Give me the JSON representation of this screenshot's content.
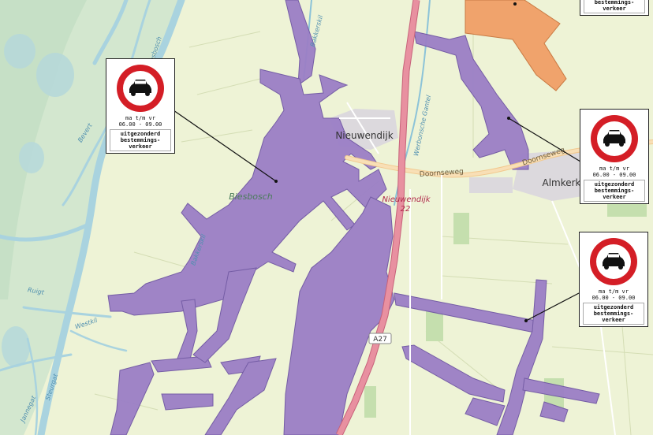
{
  "colors": {
    "background": "#eef3d6",
    "water": "#a9d3df",
    "wetland": "#cfe6d2",
    "forest": "#c8dfb3",
    "purple_zone": "#9b7fc6",
    "purple_stroke": "#6f55a3",
    "orange_zone": "#f0a36c",
    "motorway": "#e890a0",
    "secondary_road": "#f6d7a7",
    "residential": "#dedede"
  },
  "places": {
    "nieuwendijk": "Nieuwendijk",
    "almkerk": "Almkerk",
    "biesbosch": "Biesbosch"
  },
  "roads": {
    "a27": "A27",
    "exit_name": "Nieuwendijk",
    "exit_number": "22",
    "doornseweg_west": "Doornseweg",
    "doornseweg_east": "Doornseweg"
  },
  "waterways": {
    "bakkerskil": "Bakkerskil",
    "bakkerskil_south": "Bakkerskil",
    "oude_biesbosch": "Oude Biesbosch",
    "bevert": "Bevert",
    "ruigt": "Ruigt",
    "westkil": "Westkil",
    "steurgat": "Steurgat",
    "jannegat": "Jannegat",
    "gantel": "Werbonsche Gantel"
  },
  "sign": {
    "icon": "no-motor-vehicles-sign-icon",
    "days": "ma t/m vr",
    "time": "06.00 - 09.00",
    "exception_1": "uitgezonderd",
    "exception_2": "bestemmings-",
    "exception_3": "verkeer"
  }
}
